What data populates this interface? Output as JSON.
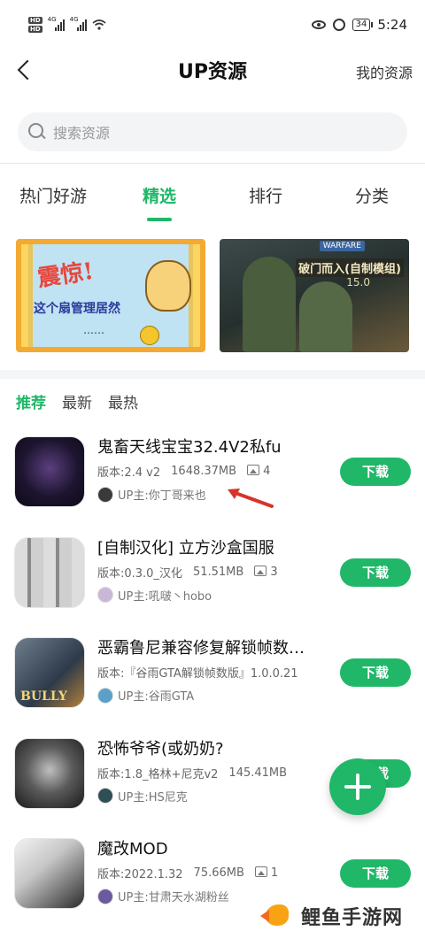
{
  "status_bar": {
    "hd_top": "HD",
    "hd_bottom": "HD",
    "net1": "4G",
    "net2": "4G",
    "battery": "34",
    "time": "5:24"
  },
  "header": {
    "title": "UP资源",
    "right_link": "我的资源"
  },
  "search": {
    "placeholder": "搜索资源"
  },
  "tabs": [
    {
      "label": "热门好游",
      "active": false
    },
    {
      "label": "精选",
      "active": true
    },
    {
      "label": "排行",
      "active": false
    },
    {
      "label": "分类",
      "active": false
    }
  ],
  "banners": [
    {
      "shock": "震惊!",
      "sub": "这个扇管理居然",
      "dots": "……"
    },
    {
      "badge": "WARFARE",
      "title": "破门而入(自制模组)",
      "ver": "15.0"
    }
  ],
  "subtabs": [
    {
      "label": "推荐",
      "active": true
    },
    {
      "label": "最新",
      "active": false
    },
    {
      "label": "最热",
      "active": false
    }
  ],
  "apps": [
    {
      "name": "鬼畜天线宝宝32.4V2私fu",
      "version": "版本:2.4 v2",
      "size": "1648.37MB",
      "images": "4",
      "uploader": "UP主:你丁哥来也",
      "download": "下载"
    },
    {
      "name": "[自制汉化] 立方沙盒国服",
      "version": "版本:0.3.0_汉化",
      "size": "51.51MB",
      "images": "3",
      "uploader": "UP主:吼啵丶hobo",
      "download": "下载"
    },
    {
      "name": "恶霸鲁尼兼容修复解锁帧数…",
      "version": "版本:『谷雨GTA解锁帧数版』1.0.0.21",
      "size": "",
      "images": "",
      "uploader": "UP主:谷雨GTA",
      "download": "下载",
      "icon_text": "BULLY"
    },
    {
      "name": "恐怖爷爷(或奶奶?",
      "version": "版本:1.8_格林+尼克v2",
      "size": "145.41MB",
      "images": "",
      "uploader": "UP主:HS尼克",
      "download": "下载"
    },
    {
      "name": "魔改MOD",
      "version": "版本:2022.1.32",
      "size": "75.66MB",
      "images": "1",
      "uploader": "UP主:甘肃天水湖粉丝",
      "download": "下载"
    }
  ],
  "watermark": "鲤鱼手游网",
  "colors": {
    "accent": "#20b768",
    "arrow": "#d8332b"
  }
}
